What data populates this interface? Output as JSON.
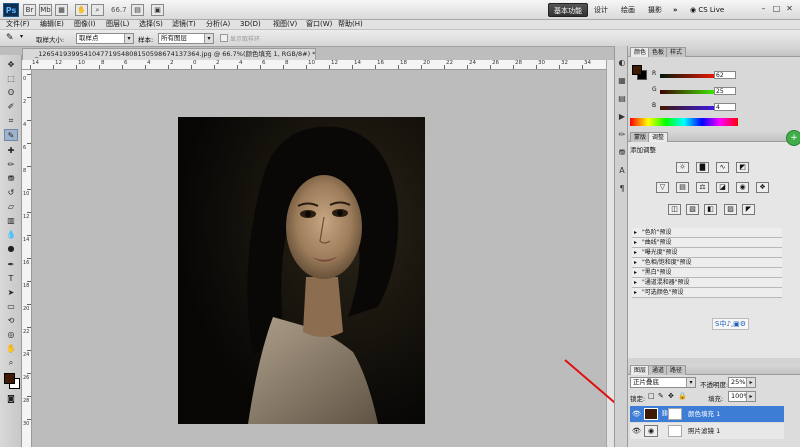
{
  "menubar": {
    "app_logo": "Ps",
    "items": [
      "文件(F)",
      "编辑(E)",
      "图像(I)",
      "图层(L)",
      "选择(S)",
      "滤镜(T)",
      "分析(A)",
      "3D(D)",
      "视图(V)",
      "窗口(W)",
      "帮助(H)"
    ],
    "zoom": "66.7",
    "workspaces": [
      "基本功能",
      "设计",
      "绘画",
      "摄影"
    ],
    "overflow": "»",
    "cs_live": "CS Live",
    "window_controls": [
      "–",
      "□",
      "✕"
    ]
  },
  "options_bar": {
    "sample_size_label": "取样大小:",
    "sample_size_value": "取样点",
    "sample_label": "样本:",
    "sample_value": "所有图层",
    "ring_label": "显示取样环"
  },
  "document": {
    "tab_title": "_12654193995410477195480815059867413736​4.jpg @ 66.7%(颜色填充 1, RGB/8#) *",
    "close": "×",
    "ruler_h_labels": [
      "14",
      "12",
      "10",
      "8",
      "6",
      "4",
      "2",
      "0",
      "2",
      "4",
      "6",
      "8",
      "10",
      "12",
      "14",
      "16",
      "18",
      "20",
      "22",
      "24",
      "26",
      "28",
      "30",
      "32",
      "34"
    ],
    "ruler_v_labels": [
      "0",
      "2",
      "4",
      "6",
      "8",
      "10",
      "12",
      "14",
      "16",
      "18",
      "20",
      "22",
      "24",
      "26",
      "28",
      "30"
    ]
  },
  "color_panel": {
    "tabs": [
      "颜色",
      "色板",
      "样式"
    ],
    "channels": [
      {
        "name": "R",
        "value": "62"
      },
      {
        "name": "G",
        "value": "25"
      },
      {
        "name": "B",
        "value": "4"
      }
    ],
    "foreground": "#3e1904",
    "background": "#000000"
  },
  "adjust_panel": {
    "tabs": [
      "蒙版",
      "调整"
    ],
    "title": "添加调整",
    "presets": [
      "\"色阶\"预设",
      "\"曲线\"预设",
      "\"曝光度\"预设",
      "\"色相/饱和度\"预设",
      "\"黑白\"预设",
      "\"通道混和器\"预设",
      "\"可选颜色\"预设"
    ],
    "ime_bar": "S中♪,▣⚙"
  },
  "layers_panel": {
    "tabs": [
      "图层",
      "通道",
      "路径"
    ],
    "blend_mode": "正片叠底",
    "opacity_label": "不透明度:",
    "opacity_value": "25%",
    "lock_label": "锁定:",
    "fill_label": "填充:",
    "fill_value": "100%",
    "layers": [
      {
        "name": "颜色填充 1",
        "selected": true
      },
      {
        "name": "照片滤镜 1",
        "selected": false
      }
    ]
  },
  "colors": {
    "accent_selected": "#3d7dd6",
    "annotation_arrow": "#e01010",
    "fg_swatch": "#3e1904"
  }
}
